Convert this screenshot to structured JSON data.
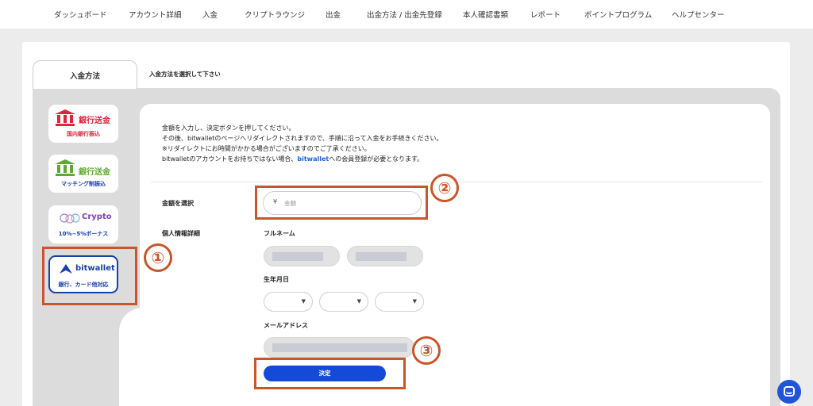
{
  "topnav": {
    "items": [
      {
        "label": "ダッシュボード"
      },
      {
        "label": "アカウント詳細"
      },
      {
        "label": "入金"
      },
      {
        "label": "クリプトラウンジ"
      },
      {
        "label": "出金"
      },
      {
        "label": "出金方法 / 出金先登録"
      },
      {
        "label": "本人確認書類"
      },
      {
        "label": "レポート"
      },
      {
        "label": "ポイントプログラム"
      },
      {
        "label": "ヘルプセンター"
      }
    ]
  },
  "tabs": {
    "active_label": "入金方法",
    "hint": "入金方法を選択して下さい"
  },
  "methods": [
    {
      "title": "銀行送金",
      "sub": "国内銀行振込",
      "color": "#e0243c"
    },
    {
      "title": "銀行送金",
      "sub": "マッチング制振込",
      "color": "#5cab2f"
    },
    {
      "title": "Crypto",
      "sub": "10%~5%ボーナス",
      "color": "#7b3fb7"
    },
    {
      "title": "bitwallet",
      "sub": "銀行、カード他対応",
      "color": "#1a3fa8"
    }
  ],
  "info": {
    "line1": "金額を入力し、決定ボタンを押してください。",
    "line2": "その後、bitwalletのページへリダイレクトされますので、手順に沿って入金をお手続きください。",
    "line3": "※リダイレクトにお時間がかかる場合がございますのでご了承ください。",
    "line4_pre": "bitwalletのアカウントをお持ちではない場合、",
    "line4_link": "bitwallet",
    "line4_post": "への会員登録が必要となります。"
  },
  "form": {
    "amount_label": "金額を選択",
    "currency_symbol": "¥",
    "amount_placeholder": "金額",
    "personal_label": "個人情報詳細",
    "fullname_label": "フルネーム",
    "birthdate_label": "生年月日",
    "email_label": "メールアドレス",
    "submit_label": "決定"
  },
  "annotations": {
    "n1": "①",
    "n2": "②",
    "n3": "③",
    "color": "#c9552b"
  },
  "colors": {
    "accent": "#1549d8",
    "link": "#1a63d8"
  }
}
